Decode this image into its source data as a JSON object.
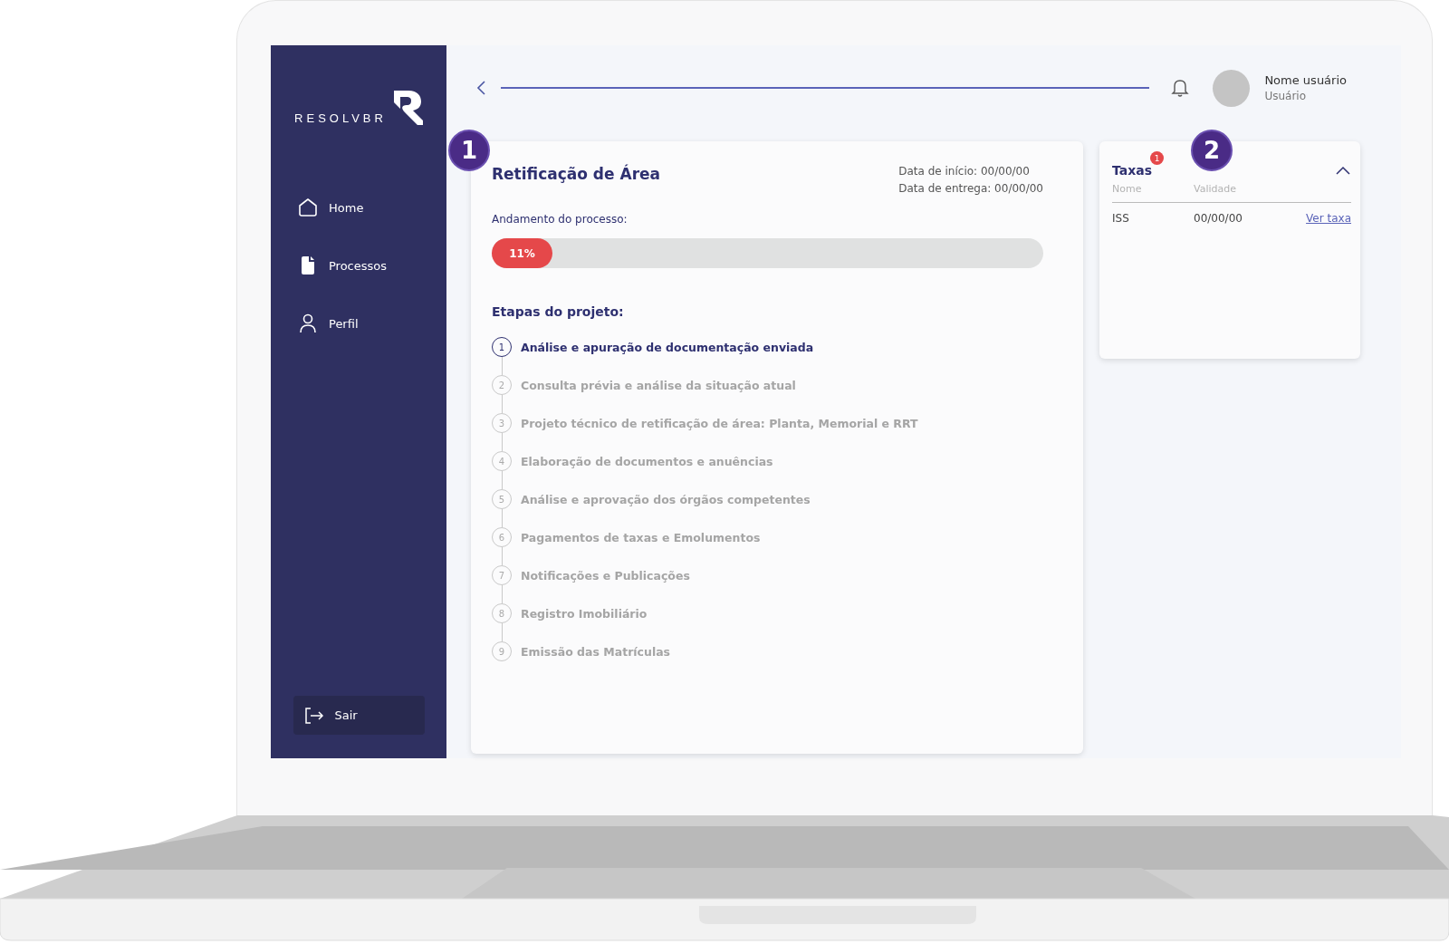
{
  "sidebar": {
    "logo_text": "RESOLVBR",
    "items": [
      {
        "label": "Home",
        "selected": false
      },
      {
        "label": "Processos",
        "selected": false
      },
      {
        "label": "Perfil",
        "selected": false
      }
    ],
    "logout": "Sair"
  },
  "header": {
    "user_name": "Nome usuário",
    "user_role": "Usuário"
  },
  "process": {
    "title": "Retificação de Área",
    "start_date": "Data de início: 00/00/00",
    "delivery_date": "Data de entrega: 00/00/00",
    "progress_label": "Andamento do processo:",
    "progress": {
      "level": 0.11,
      "reading": "11%"
    },
    "steps_title": "Etapas do projeto:",
    "steps": [
      {
        "number": "1",
        "label": "Análise e apuração de documentação enviada",
        "current": true
      },
      {
        "number": "2",
        "label": "Consulta prévia e análise da situação atual",
        "current": false
      },
      {
        "number": "3",
        "label": "Projeto técnico de retificação de área: Planta, Memorial e RRT",
        "current": false
      },
      {
        "number": "4",
        "label": "Elaboração de documentos e anuências",
        "current": false
      },
      {
        "number": "5",
        "label": "Análise e aprovação dos órgãos competentes",
        "current": false
      },
      {
        "number": "6",
        "label": "Pagamentos de taxas e Emolumentos",
        "current": false
      },
      {
        "number": "7",
        "label": "Notificações e Publicações",
        "current": false
      },
      {
        "number": "8",
        "label": "Registro Imobiliário",
        "current": false
      },
      {
        "number": "9",
        "label": "Emissão das Matrículas",
        "current": false
      }
    ]
  },
  "fees": {
    "title": "Taxas",
    "badge": "1",
    "expanded": true,
    "columns": [
      "Nome",
      "Validade"
    ],
    "rows": [
      {
        "name": "ISS",
        "validity": "00/00/00",
        "link": "Ver taxa"
      }
    ]
  },
  "callouts": [
    "1",
    "2"
  ]
}
